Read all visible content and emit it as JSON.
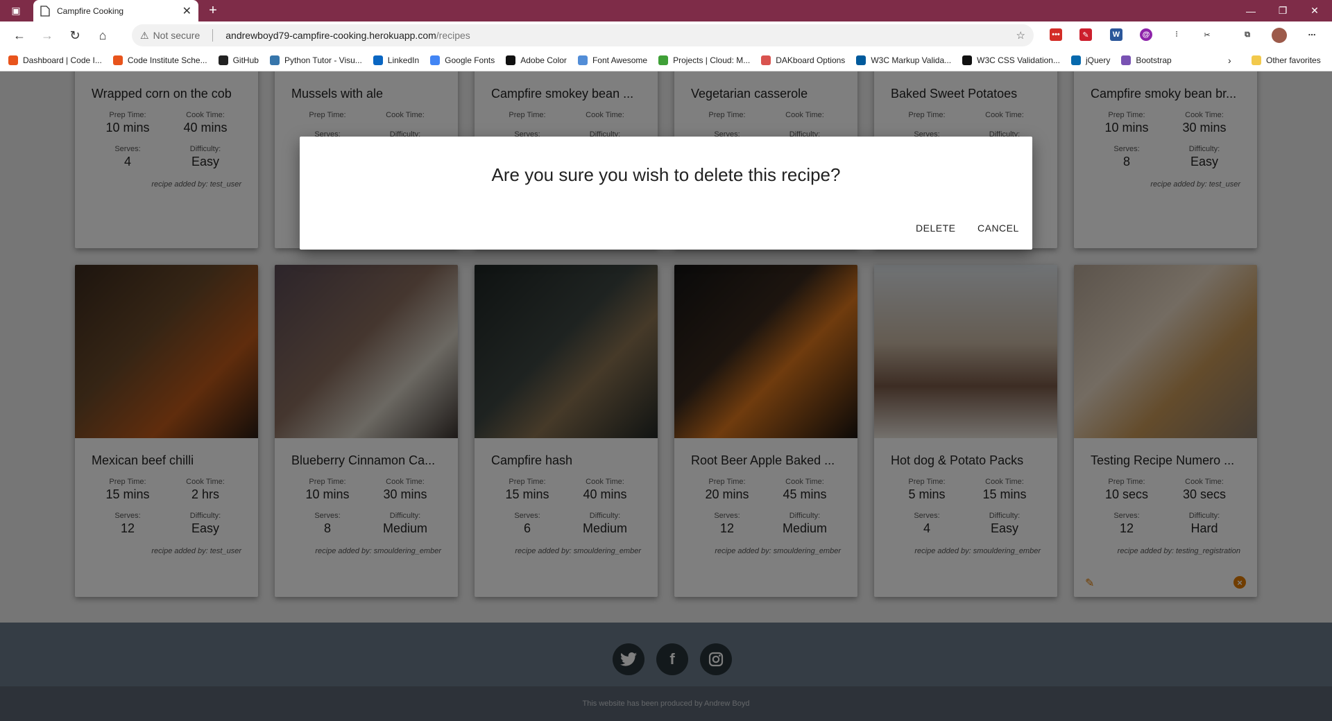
{
  "browser": {
    "tab_title": "Campfire Cooking",
    "new_tab": "+",
    "tab_close": "✕",
    "not_secure": "Not secure",
    "url_host": "andrewboyd79-campfire-cooking.herokuapp.com",
    "url_path": "/recipes",
    "bookmarks": [
      {
        "label": "Dashboard | Code I...",
        "color": "#e8541c"
      },
      {
        "label": "Code Institute Sche...",
        "color": "#e8541c"
      },
      {
        "label": "GitHub",
        "color": "#222222"
      },
      {
        "label": "Python Tutor - Visu...",
        "color": "#3776ab"
      },
      {
        "label": "LinkedIn",
        "color": "#0a66c2"
      },
      {
        "label": "Google Fonts",
        "color": "#4285f4"
      },
      {
        "label": "Adobe Color",
        "color": "#111111"
      },
      {
        "label": "Font Awesome",
        "color": "#528dd7"
      },
      {
        "label": "Projects | Cloud: M...",
        "color": "#3fa037"
      },
      {
        "label": "DAKboard Options",
        "color": "#d9534f"
      },
      {
        "label": "W3C Markup Valida...",
        "color": "#005a9c"
      },
      {
        "label": "W3C CSS Validation...",
        "color": "#111111"
      },
      {
        "label": "jQuery",
        "color": "#0769ad"
      },
      {
        "label": "Bootstrap",
        "color": "#7952b3"
      }
    ],
    "other_favorites": "Other favorites"
  },
  "recipes_row1": [
    {
      "title": "Wrapped corn on the cob",
      "prep": "10 mins",
      "cook": "40 mins",
      "serves": "4",
      "difficulty": "Easy",
      "added": "recipe added by: test_user"
    },
    {
      "title": "Mussels with ale",
      "prep": "",
      "cook": "",
      "serves": "",
      "difficulty": "",
      "added": ""
    },
    {
      "title": "Campfire smokey bean ...",
      "prep": "",
      "cook": "",
      "serves": "",
      "difficulty": "",
      "added": ""
    },
    {
      "title": "Vegetarian casserole",
      "prep": "",
      "cook": "",
      "serves": "",
      "difficulty": "",
      "added": ""
    },
    {
      "title": "Baked Sweet Potatoes",
      "prep": "",
      "cook": "",
      "serves": "",
      "difficulty": "",
      "added": ""
    },
    {
      "title": "Campfire smoky bean br...",
      "prep": "10 mins",
      "cook": "30 mins",
      "serves": "8",
      "difficulty": "Easy",
      "added": "recipe added by: test_user"
    }
  ],
  "recipes_row2": [
    {
      "title": "Mexican beef chilli",
      "prep": "15 mins",
      "cook": "2 hrs",
      "serves": "12",
      "difficulty": "Easy",
      "added": "recipe added by: test_user"
    },
    {
      "title": "Blueberry Cinnamon Ca...",
      "prep": "10 mins",
      "cook": "30 mins",
      "serves": "8",
      "difficulty": "Medium",
      "added": "recipe added by: smouldering_ember"
    },
    {
      "title": "Campfire hash",
      "prep": "15 mins",
      "cook": "40 mins",
      "serves": "6",
      "difficulty": "Medium",
      "added": "recipe added by: smouldering_ember"
    },
    {
      "title": "Root Beer Apple Baked ...",
      "prep": "20 mins",
      "cook": "45 mins",
      "serves": "12",
      "difficulty": "Medium",
      "added": "recipe added by: smouldering_ember"
    },
    {
      "title": "Hot dog & Potato Packs",
      "prep": "5 mins",
      "cook": "15 mins",
      "serves": "4",
      "difficulty": "Easy",
      "added": "recipe added by: smouldering_ember"
    },
    {
      "title": "Testing Recipe Numero ...",
      "prep": "10 secs",
      "cook": "30 secs",
      "serves": "12",
      "difficulty": "Hard",
      "added": "recipe added by: testing_registration"
    }
  ],
  "labels": {
    "prep": "Prep Time:",
    "cook": "Cook Time:",
    "serves": "Serves:",
    "difficulty": "Difficulty:"
  },
  "modal": {
    "question": "Are you sure you wish to delete this recipe?",
    "delete": "DELETE",
    "cancel": "CANCEL"
  },
  "footer": {
    "credit": "This website has been produced by Andrew Boyd"
  },
  "colors": {
    "accent": "#e07b00",
    "titlebar": "#7e2c48"
  }
}
